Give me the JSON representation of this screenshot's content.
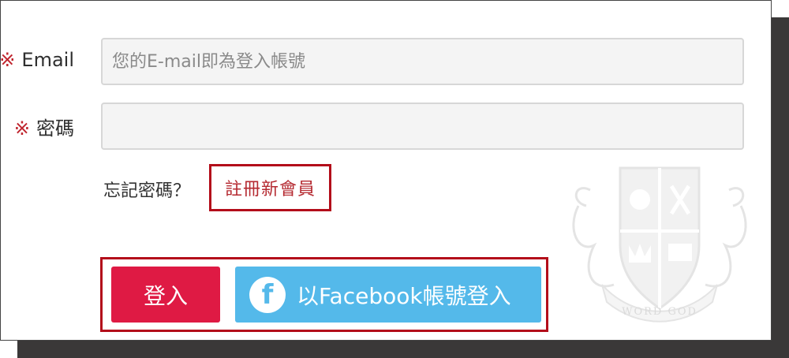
{
  "form": {
    "required_mark": "※",
    "email": {
      "label": "Email",
      "placeholder": "您的E-mail即為登入帳號",
      "value": ""
    },
    "password": {
      "label": "密碼",
      "value": ""
    }
  },
  "links": {
    "forgot_password": "忘記密碼？",
    "register": "註冊新會員"
  },
  "buttons": {
    "login": "登入",
    "facebook_login": "以Facebook帳號登入",
    "facebook_icon_glyph": "f"
  },
  "crest": {
    "motto": "WORD GOD"
  },
  "colors": {
    "required": "#c0262f",
    "login_button": "#df1a44",
    "facebook_button": "#54b9ea",
    "highlight_border": "#b30d1a"
  }
}
